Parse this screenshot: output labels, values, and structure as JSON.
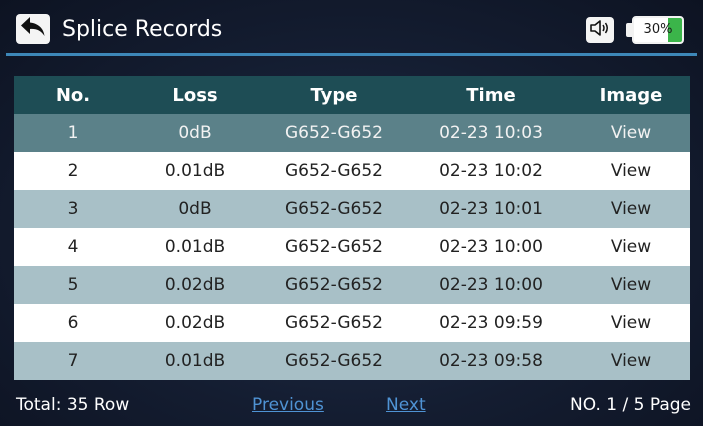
{
  "header": {
    "title": "Splice Records",
    "back_icon": "arrow-back-icon",
    "sound_icon": "speaker-icon",
    "battery": {
      "label": "30%",
      "level_percent": 30,
      "fill_color": "#3bb54a"
    }
  },
  "table": {
    "columns": [
      "No.",
      "Loss",
      "Type",
      "Time",
      "Image"
    ],
    "selected_row": 0,
    "rows": [
      {
        "no": "1",
        "loss": "0dB",
        "type": "G652-G652",
        "time": "02-23 10:03",
        "image": "View"
      },
      {
        "no": "2",
        "loss": "0.01dB",
        "type": "G652-G652",
        "time": "02-23 10:02",
        "image": "View"
      },
      {
        "no": "3",
        "loss": "0dB",
        "type": "G652-G652",
        "time": "02-23 10:01",
        "image": "View"
      },
      {
        "no": "4",
        "loss": "0.01dB",
        "type": "G652-G652",
        "time": "02-23 10:00",
        "image": "View"
      },
      {
        "no": "5",
        "loss": "0.02dB",
        "type": "G652-G652",
        "time": "02-23 10:00",
        "image": "View"
      },
      {
        "no": "6",
        "loss": "0.02dB",
        "type": "G652-G652",
        "time": "02-23 09:59",
        "image": "View"
      },
      {
        "no": "7",
        "loss": "0.01dB",
        "type": "G652-G652",
        "time": "02-23 09:58",
        "image": "View"
      }
    ]
  },
  "footer": {
    "total": "Total: 35 Row",
    "previous": "Previous",
    "next": "Next",
    "page": "NO. 1 / 5 Page"
  },
  "colors": {
    "header_row": "#1e4d55",
    "selected_row": "#5b8189",
    "striped_row": "#a8c0c7",
    "accent_line": "#3d87b8",
    "link": "#4f93d4"
  }
}
